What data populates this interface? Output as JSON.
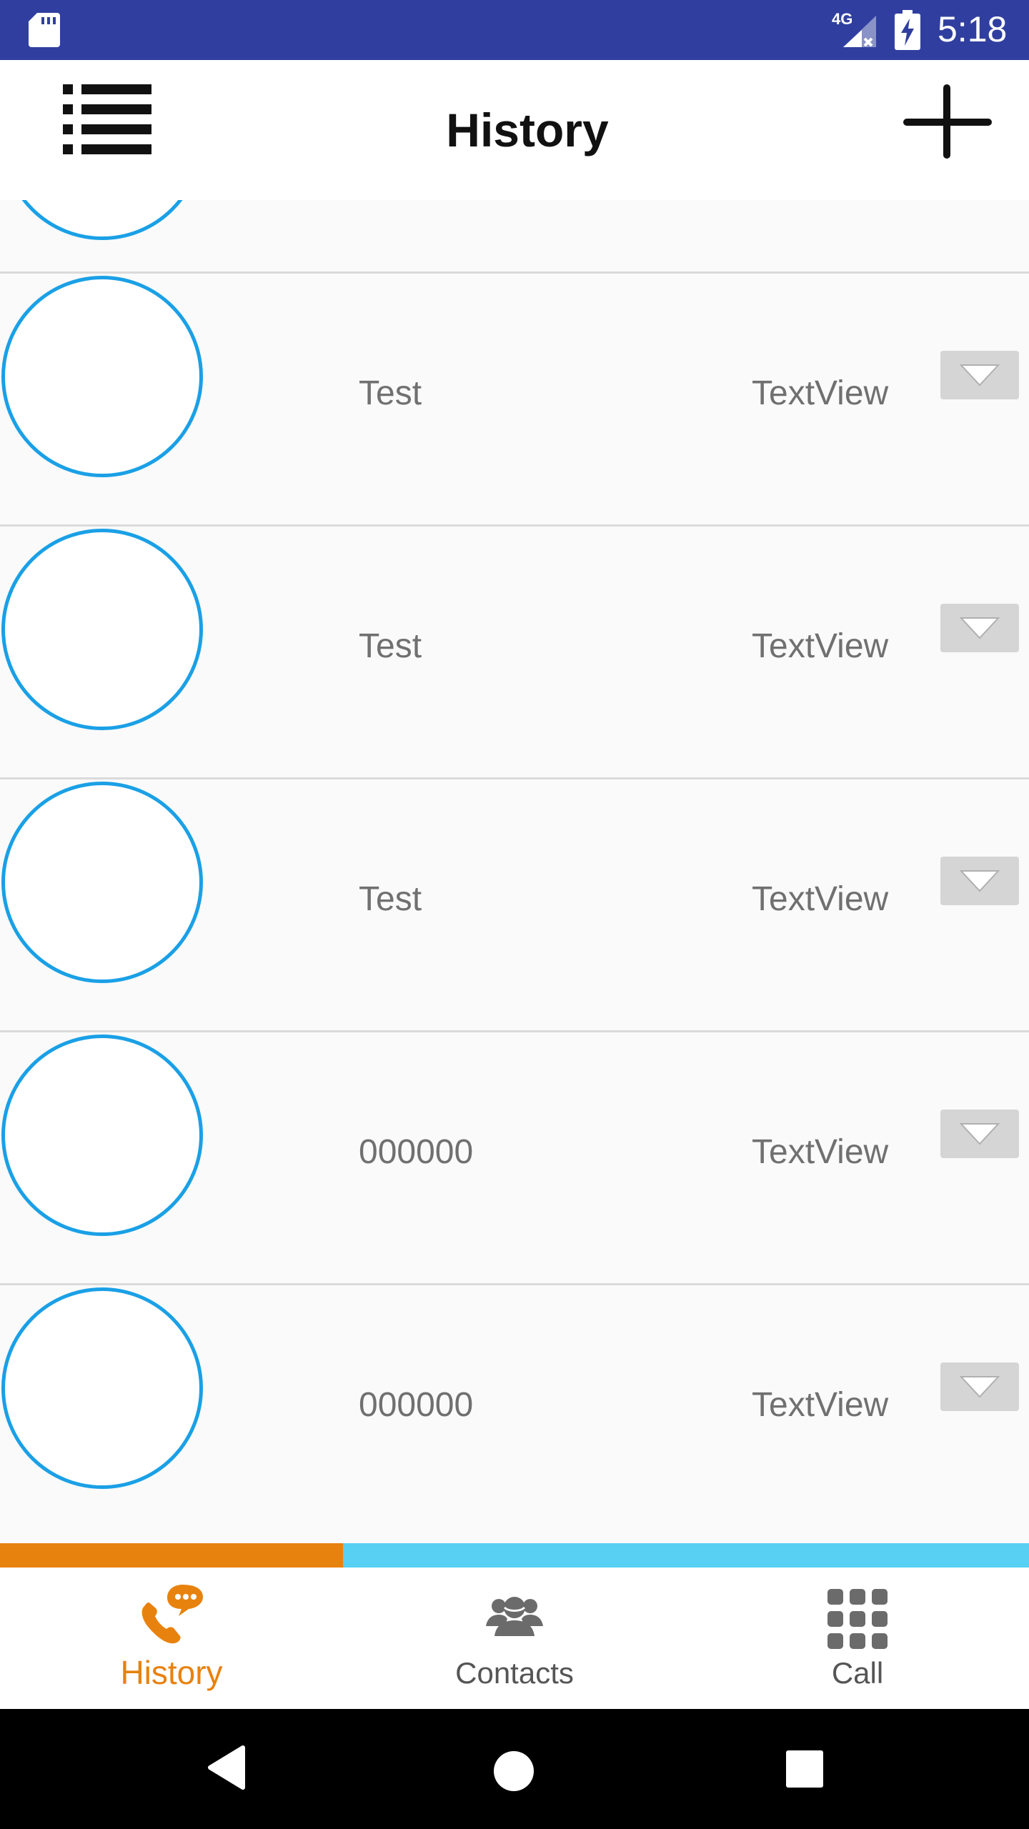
{
  "status_bar": {
    "network": "4G",
    "time": "5:18",
    "icons": [
      "sd-card-icon",
      "signal-icon",
      "battery-charging-icon"
    ]
  },
  "app_bar": {
    "title": "History",
    "left_icon": "menu-list-icon",
    "right_icon": "add-icon"
  },
  "rows": [
    {
      "name": "Test",
      "detail": "TextView"
    },
    {
      "name": "Test",
      "detail": "TextView"
    },
    {
      "name": "Test",
      "detail": "TextView"
    },
    {
      "name": "000000",
      "detail": "TextView"
    },
    {
      "name": "000000",
      "detail": "TextView"
    }
  ],
  "tabs": [
    {
      "label": "History",
      "icon": "phone-chat-icon",
      "active": true
    },
    {
      "label": "Contacts",
      "icon": "contacts-group-icon",
      "active": false
    },
    {
      "label": "Call",
      "icon": "dialpad-icon",
      "active": false
    }
  ],
  "colors": {
    "status_bar": "#303f9f",
    "accent_orange": "#e8820e",
    "accent_cyan": "#58d0f4",
    "avatar_ring": "#1aa0e6"
  }
}
